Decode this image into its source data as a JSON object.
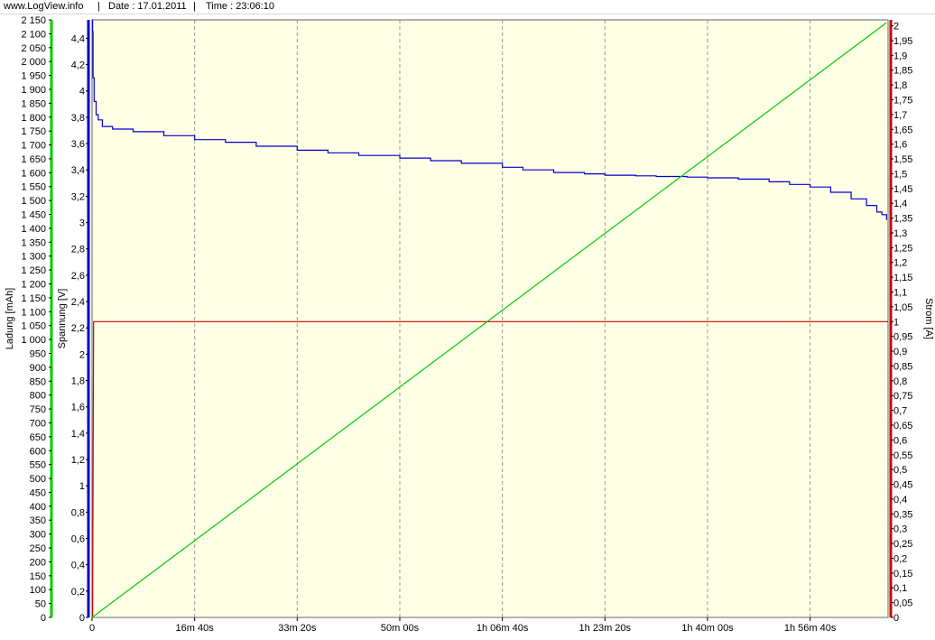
{
  "header": {
    "site": "www.LogView.info",
    "sep": "|",
    "date": "Date : 17.01.2011",
    "time": "Time : 23:06:10"
  },
  "chart_data": {
    "type": "line",
    "x_ticks": [
      "0",
      "16m 40s",
      "33m 20s",
      "50m 00s",
      "1h 06m 40s",
      "1h 23m 20s",
      "1h 40m 00s",
      "1h 56m 40s"
    ],
    "x_tick_seconds": [
      0,
      1000,
      2000,
      3000,
      4000,
      5000,
      6000,
      7000
    ],
    "xlim": [
      0,
      7760
    ],
    "grid": "vertical dashed",
    "background": "#ffffe6",
    "axes": {
      "charge": {
        "label": "Ladung [mAh]",
        "color": "#00cc00",
        "side": "left-outer",
        "lim": [
          0,
          2150
        ],
        "ticks": [
          "0",
          "50",
          "100",
          "150",
          "200",
          "250",
          "300",
          "350",
          "400",
          "450",
          "500",
          "550",
          "600",
          "650",
          "700",
          "750",
          "800",
          "850",
          "900",
          "950",
          "1 000",
          "1 050",
          "1 100",
          "1 150",
          "1 200",
          "1 250",
          "1 300",
          "1 350",
          "1 400",
          "1 450",
          "1 500",
          "1 550",
          "1 600",
          "1 650",
          "1 700",
          "1 750",
          "1 800",
          "1 850",
          "1 900",
          "1 950",
          "2 000",
          "2 050",
          "2 100",
          "2 150"
        ]
      },
      "voltage": {
        "label": "Spannung [V]",
        "color": "#0000cc",
        "side": "left-inner",
        "lim": [
          0,
          4.54
        ],
        "ticks": [
          "0",
          "0,2",
          "0,4",
          "0,6",
          "0,8",
          "1",
          "1,2",
          "1,4",
          "1,6",
          "1,8",
          "2",
          "2,2",
          "2,4",
          "2,6",
          "2,8",
          "3",
          "3,2",
          "3,4",
          "3,6",
          "3,8",
          "4",
          "4,2",
          "4,4"
        ]
      },
      "current": {
        "label": "Strom [A]",
        "color": "#cc0000",
        "side": "right",
        "lim": [
          0,
          2.02
        ],
        "ticks": [
          "0",
          "0,05",
          "0,1",
          "0,15",
          "0,2",
          "0,25",
          "0,3",
          "0,35",
          "0,4",
          "0,45",
          "0,5",
          "0,55",
          "0,6",
          "0,65",
          "0,7",
          "0,75",
          "0,8",
          "0,85",
          "0,9",
          "0,95",
          "1",
          "1,05",
          "1,1",
          "1,15",
          "1,2",
          "1,25",
          "1,3",
          "1,35",
          "1,4",
          "1,45",
          "1,5",
          "1,55",
          "1,6",
          "1,65",
          "1,7",
          "1,75",
          "1,8",
          "1,85",
          "1,9",
          "1,95",
          "2"
        ]
      }
    },
    "series": [
      {
        "name": "Spannung",
        "axis": "voltage",
        "color": "#0000cc",
        "x": [
          0,
          5,
          10,
          20,
          40,
          60,
          100,
          200,
          400,
          700,
          1000,
          1300,
          1600,
          2000,
          2300,
          2600,
          3000,
          3300,
          3600,
          4000,
          4200,
          4500,
          4800,
          5000,
          5300,
          5500,
          5800,
          6000,
          6300,
          6600,
          6800,
          7000,
          7200,
          7400,
          7550,
          7650,
          7700,
          7745
        ],
        "y": [
          4.54,
          4.45,
          4.1,
          3.92,
          3.82,
          3.78,
          3.73,
          3.71,
          3.69,
          3.66,
          3.63,
          3.61,
          3.58,
          3.55,
          3.53,
          3.51,
          3.49,
          3.47,
          3.45,
          3.42,
          3.4,
          3.38,
          3.37,
          3.36,
          3.355,
          3.35,
          3.345,
          3.34,
          3.33,
          3.31,
          3.29,
          3.27,
          3.23,
          3.18,
          3.13,
          3.08,
          3.06,
          3.02
        ]
      },
      {
        "name": "Strom",
        "axis": "current",
        "color": "#cc0000",
        "x": [
          0,
          5,
          15,
          7760
        ],
        "y": [
          0,
          0,
          1.0,
          1.0
        ]
      },
      {
        "name": "Ladung",
        "axis": "charge",
        "color": "#00cc00",
        "x": [
          0,
          7745
        ],
        "y": [
          0,
          2140
        ]
      }
    ]
  }
}
